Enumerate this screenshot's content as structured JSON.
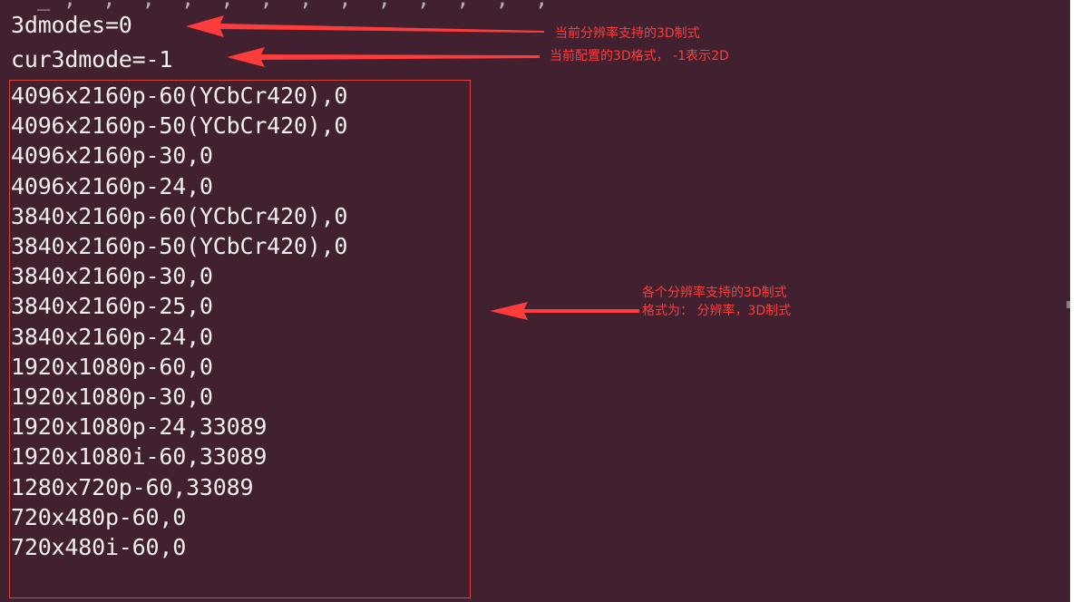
{
  "terminal": {
    "partial_top_line": "  _ ,  ,  ,  ,  ,  ,  ,  ,  ,  ,  ,  ,  ,  ",
    "status_lines": [
      "3dmodes=0",
      "cur3dmode=-1"
    ],
    "resolutions": [
      "4096x2160p-60(YCbCr420),0",
      "4096x2160p-50(YCbCr420),0",
      "4096x2160p-30,0",
      "4096x2160p-24,0",
      "3840x2160p-60(YCbCr420),0",
      "3840x2160p-50(YCbCr420),0",
      "3840x2160p-30,0",
      "3840x2160p-25,0",
      "3840x2160p-24,0",
      "1920x1080p-60,0",
      "1920x1080p-30,0",
      "1920x1080p-24,33089",
      "1920x1080i-60,33089",
      "1280x720p-60,33089",
      "720x480p-60,0",
      "720x480i-60,0"
    ]
  },
  "annotations": {
    "modes_note": "当前分辨率支持的3D制式",
    "cur_mode_note": "当前配置的3D格式， -1表示2D",
    "list_note_line1": "各个分辨率支持的3D制式",
    "list_note_line2": "格式为： 分辨率，3D制式"
  },
  "colors": {
    "terminal_bg": "#41212f",
    "terminal_text": "#f1eeee",
    "annotation_red": "#ff3c3c",
    "box_border": "#e2403d"
  }
}
